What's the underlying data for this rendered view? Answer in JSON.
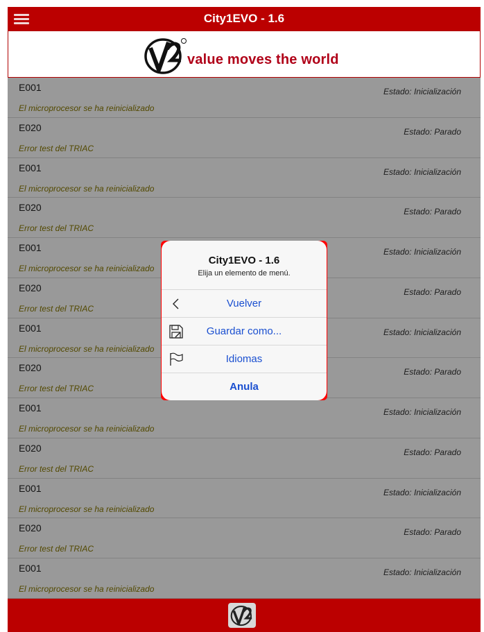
{
  "app": {
    "title": "City1EVO - 1.6",
    "tagline": "value moves the world",
    "colors": {
      "brand_red": "#bb0000",
      "link_blue": "#1a4fd0",
      "desc_olive": "#8a7a00"
    }
  },
  "topbar": {
    "menu_icon": "hamburger-menu-icon"
  },
  "log": {
    "rows": [
      {
        "code": "E001",
        "description": "El microprocesor se ha reinicializado",
        "status": "Estado: Inicialización"
      },
      {
        "code": "E020",
        "description": "Error test del TRIAC",
        "status": "Estado: Parado"
      },
      {
        "code": "E001",
        "description": "El microprocesor se ha reinicializado",
        "status": "Estado: Inicialización"
      },
      {
        "code": "E020",
        "description": "Error test del TRIAC",
        "status": "Estado: Parado"
      },
      {
        "code": "E001",
        "description": "El microprocesor se ha reinicializado",
        "status": "Estado: Inicialización"
      },
      {
        "code": "E020",
        "description": "Error test del TRIAC",
        "status": "Estado: Parado"
      },
      {
        "code": "E001",
        "description": "El microprocesor se ha reinicializado",
        "status": "Estado: Inicialización"
      },
      {
        "code": "E020",
        "description": "Error test del TRIAC",
        "status": "Estado: Parado"
      },
      {
        "code": "E001",
        "description": "El microprocesor se ha reinicializado",
        "status": "Estado: Inicialización"
      },
      {
        "code": "E020",
        "description": "Error test del TRIAC",
        "status": "Estado: Parado"
      },
      {
        "code": "E001",
        "description": "El microprocesor se ha reinicializado",
        "status": "Estado: Inicialización"
      },
      {
        "code": "E020",
        "description": "Error test del TRIAC",
        "status": "Estado: Parado"
      },
      {
        "code": "E001",
        "description": "El microprocesor se ha reinicializado",
        "status": "Estado: Inicialización"
      }
    ]
  },
  "action_sheet": {
    "title": "City1EVO - 1.6",
    "subtitle": "Elija un elemento de menú.",
    "items": [
      {
        "label": "Vuelver",
        "icon": "chevron-left-icon"
      },
      {
        "label": "Guardar como...",
        "icon": "floppy-disk-icon"
      },
      {
        "label": "Idiomas",
        "icon": "flag-icon"
      }
    ],
    "cancel_label": "Anula"
  }
}
